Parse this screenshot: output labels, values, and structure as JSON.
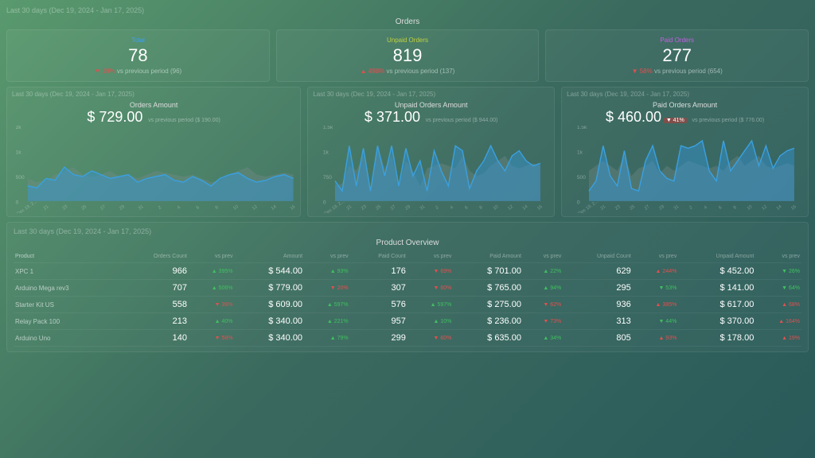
{
  "period_label": "Last 30 days (Dec 19, 2024 - Jan 17, 2025)",
  "orders_section": {
    "title": "Orders",
    "cards": [
      {
        "label": "Total",
        "label_class": "lbl-total",
        "value": "78",
        "delta_pct": "19%",
        "delta_dir": "down",
        "compare": "vs previous period (96)"
      },
      {
        "label": "Unpaid Orders",
        "label_class": "lbl-unpaid",
        "value": "819",
        "delta_pct": "498%",
        "delta_dir": "up-red",
        "compare": "vs previous period (137)"
      },
      {
        "label": "Paid Orders",
        "label_class": "lbl-paid",
        "value": "277",
        "delta_pct": "58%",
        "delta_dir": "down",
        "compare": "vs previous period (654)"
      }
    ]
  },
  "amount_charts": [
    {
      "title": "Orders Amount",
      "amount": "$ 729.00",
      "badge": null,
      "compare": "vs previous period ($ 190.00)"
    },
    {
      "title": "Unpaid Orders Amount",
      "amount": "$ 371.00",
      "badge": null,
      "compare": "vs previous period ($ 944.00)"
    },
    {
      "title": "Paid Orders Amount",
      "amount": "$ 460.00",
      "badge": "41%",
      "badge_class": "badge-red",
      "compare": "vs previous period ($ 776.00)"
    }
  ],
  "chart_data": [
    {
      "type": "area",
      "title": "Orders Amount",
      "ylabel": "",
      "ylim": [
        0,
        2000
      ],
      "y_ticks": [
        "2k",
        "1k",
        "500",
        "0"
      ],
      "x_ticks": [
        "Dec 19, 2...",
        "21",
        "23",
        "25",
        "27",
        "29",
        "31",
        "2",
        "4",
        "6",
        "8",
        "10",
        "12",
        "14",
        "16"
      ],
      "series": [
        {
          "name": "current",
          "values": [
            400,
            350,
            600,
            550,
            900,
            700,
            650,
            800,
            700,
            600,
            650,
            700,
            500,
            600,
            650,
            700,
            550,
            500,
            650,
            550,
            400,
            600,
            700,
            750,
            600,
            500,
            550,
            650,
            700,
            600
          ]
        },
        {
          "name": "previous",
          "values": [
            600,
            500,
            550,
            700,
            800,
            900,
            700,
            650,
            700,
            800,
            650,
            700,
            600,
            700,
            800,
            750,
            700,
            650,
            700,
            600,
            500,
            550,
            700,
            800,
            900,
            700,
            650,
            700,
            750,
            700
          ]
        }
      ]
    },
    {
      "type": "area",
      "title": "Unpaid Orders Amount",
      "ylim": [
        0,
        1500
      ],
      "y_ticks": [
        "1.5k",
        "1k",
        "750",
        "0"
      ],
      "x_ticks": [
        "Dec 19, 2...",
        "21",
        "23",
        "25",
        "27",
        "29",
        "31",
        "2",
        "4",
        "6",
        "8",
        "10",
        "12",
        "14",
        "16"
      ],
      "series": [
        {
          "name": "current",
          "values": [
            400,
            200,
            1100,
            300,
            1050,
            200,
            1100,
            500,
            1100,
            300,
            1050,
            500,
            800,
            200,
            1000,
            600,
            300,
            1100,
            1000,
            250,
            600,
            800,
            1100,
            800,
            600,
            900,
            1000,
            800,
            700,
            750
          ]
        },
        {
          "name": "previous",
          "values": [
            300,
            350,
            700,
            600,
            900,
            250,
            1100,
            650,
            900,
            300,
            800,
            600,
            300,
            650,
            700,
            750,
            700,
            650,
            900,
            600,
            500,
            550,
            700,
            800,
            900,
            700,
            650,
            700,
            750,
            700
          ]
        }
      ]
    },
    {
      "type": "area",
      "title": "Paid Orders Amount",
      "ylim": [
        0,
        1500
      ],
      "y_ticks": [
        "1.5k",
        "1k",
        "500",
        "0"
      ],
      "x_ticks": [
        "Dec 19, 2...",
        "21",
        "23",
        "25",
        "27",
        "29",
        "31",
        "2",
        "4",
        "6",
        "8",
        "10",
        "12",
        "14",
        "16"
      ],
      "series": [
        {
          "name": "current",
          "values": [
            200,
            400,
            1100,
            500,
            300,
            1000,
            250,
            200,
            800,
            1100,
            600,
            450,
            400,
            1100,
            1050,
            1100,
            1200,
            600,
            400,
            1200,
            600,
            800,
            1000,
            1200,
            700,
            1100,
            650,
            900,
            1000,
            1050
          ]
        },
        {
          "name": "previous",
          "values": [
            600,
            700,
            800,
            700,
            600,
            900,
            500,
            650,
            700,
            800,
            550,
            700,
            600,
            700,
            800,
            750,
            700,
            650,
            700,
            600,
            800,
            900,
            700,
            800,
            900,
            700,
            650,
            700,
            750,
            700
          ]
        }
      ]
    }
  ],
  "product_table": {
    "title": "Product Overview",
    "columns": [
      "Product",
      "Orders Count",
      "vs prev",
      "Amount",
      "vs prev",
      "Paid Count",
      "vs prev",
      "Paid Amount",
      "vs prev",
      "Unpaid Count",
      "vs prev",
      "Unpaid Amount",
      "vs prev"
    ],
    "rows": [
      {
        "product": "XPC 1",
        "orders_count": "966",
        "orders_d": "▲ 395%",
        "orders_dc": "up",
        "amount": "$ 544.00",
        "amount_d": "▲ 93%",
        "amount_dc": "up",
        "paid_count": "176",
        "paid_d": "▼ 69%",
        "paid_dc": "down",
        "paid_amount": "$ 701.00",
        "paid_ad": "▲ 22%",
        "paid_adc": "up",
        "unpaid_count": "629",
        "unpaid_d": "▲ 244%",
        "unpaid_dc": "up-red",
        "unpaid_amount": "$ 452.00",
        "unpaid_ad": "▼ 26%",
        "unpaid_adc": "down-green"
      },
      {
        "product": "Arduino Mega rev3",
        "orders_count": "707",
        "orders_d": "▲ 506%",
        "orders_dc": "up",
        "amount": "$ 779.00",
        "amount_d": "▼ 20%",
        "amount_dc": "down",
        "paid_count": "307",
        "paid_d": "▼ 60%",
        "paid_dc": "down",
        "paid_amount": "$ 765.00",
        "paid_ad": "▲ 94%",
        "paid_adc": "up",
        "unpaid_count": "295",
        "unpaid_d": "▼ 53%",
        "unpaid_dc": "down-green",
        "unpaid_amount": "$ 141.00",
        "unpaid_ad": "▼ 64%",
        "unpaid_adc": "down-green"
      },
      {
        "product": "Starter Kit US",
        "orders_count": "558",
        "orders_d": "▼ 39%",
        "orders_dc": "down",
        "amount": "$ 609.00",
        "amount_d": "▲ 597%",
        "amount_dc": "up",
        "paid_count": "576",
        "paid_d": "▲ 597%",
        "paid_dc": "up",
        "paid_amount": "$ 275.00",
        "paid_ad": "▼ 62%",
        "paid_adc": "down",
        "unpaid_count": "936",
        "unpaid_d": "▲ 385%",
        "unpaid_dc": "up-red",
        "unpaid_amount": "$ 617.00",
        "unpaid_ad": "▲ 68%",
        "unpaid_adc": "up-red"
      },
      {
        "product": "Relay Pack 100",
        "orders_count": "213",
        "orders_d": "▲ 40%",
        "orders_dc": "up",
        "amount": "$ 340.00",
        "amount_d": "▲ 221%",
        "amount_dc": "up",
        "paid_count": "957",
        "paid_d": "▲ 10%",
        "paid_dc": "up",
        "paid_amount": "$ 236.00",
        "paid_ad": "▼ 73%",
        "paid_adc": "down",
        "unpaid_count": "313",
        "unpaid_d": "▼ 44%",
        "unpaid_dc": "down-green",
        "unpaid_amount": "$ 370.00",
        "unpaid_ad": "▲ 164%",
        "unpaid_adc": "up-red"
      },
      {
        "product": "Arduino Uno",
        "orders_count": "140",
        "orders_d": "▼ 58%",
        "orders_dc": "down",
        "amount": "$ 340.00",
        "amount_d": "▲ 79%",
        "amount_dc": "up",
        "paid_count": "299",
        "paid_d": "▼ 60%",
        "paid_dc": "down",
        "paid_amount": "$ 635.00",
        "paid_ad": "▲ 34%",
        "paid_adc": "up",
        "unpaid_count": "805",
        "unpaid_d": "▲ 93%",
        "unpaid_dc": "up-red",
        "unpaid_amount": "$ 178.00",
        "unpaid_ad": "▲ 19%",
        "unpaid_adc": "up-red"
      }
    ]
  }
}
